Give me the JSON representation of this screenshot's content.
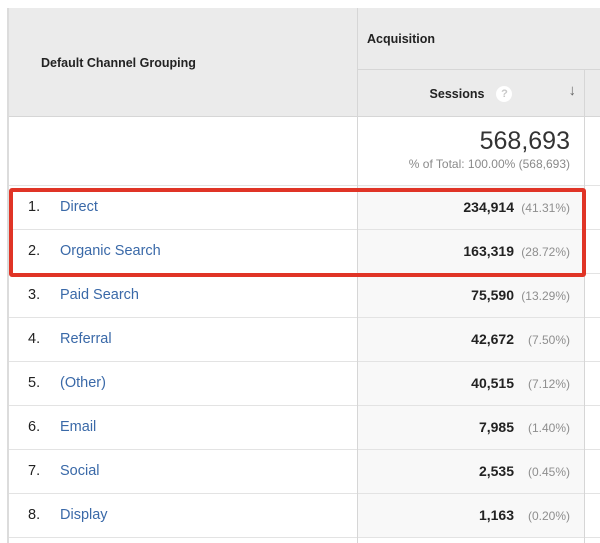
{
  "header": {
    "dimension_label": "Default Channel Grouping",
    "group_label": "Acquisition",
    "metric_label": "Sessions",
    "help_glyph": "?",
    "help_icon": "question-circle-icon",
    "sort_glyph": "↓",
    "sort_icon": "sort-descending-arrow-icon"
  },
  "totals": {
    "value": "568,693",
    "subtitle": "% of Total: 100.00% (568,693)"
  },
  "rows": [
    {
      "index": "1.",
      "channel": "Direct",
      "sessions": "234,914",
      "percent": "(41.31%)"
    },
    {
      "index": "2.",
      "channel": "Organic Search",
      "sessions": "163,319",
      "percent": "(28.72%)"
    },
    {
      "index": "3.",
      "channel": "Paid Search",
      "sessions": "75,590",
      "percent": "(13.29%)"
    },
    {
      "index": "4.",
      "channel": "Referral",
      "sessions": "42,672",
      "percent": "(7.50%)"
    },
    {
      "index": "5.",
      "channel": "(Other)",
      "sessions": "40,515",
      "percent": "(7.12%)"
    },
    {
      "index": "6.",
      "channel": "Email",
      "sessions": "7,985",
      "percent": "(1.40%)"
    },
    {
      "index": "7.",
      "channel": "Social",
      "sessions": "2,535",
      "percent": "(0.45%)"
    },
    {
      "index": "8.",
      "channel": "Display",
      "sessions": "1,163",
      "percent": "(0.20%)"
    }
  ],
  "highlight": {
    "color": "#e03426",
    "rows_highlighted": [
      "Direct",
      "Organic Search"
    ]
  },
  "colors": {
    "link": "#3a69a8",
    "header_bg": "#ebebeb",
    "metric_bg": "#f8f8f8"
  }
}
